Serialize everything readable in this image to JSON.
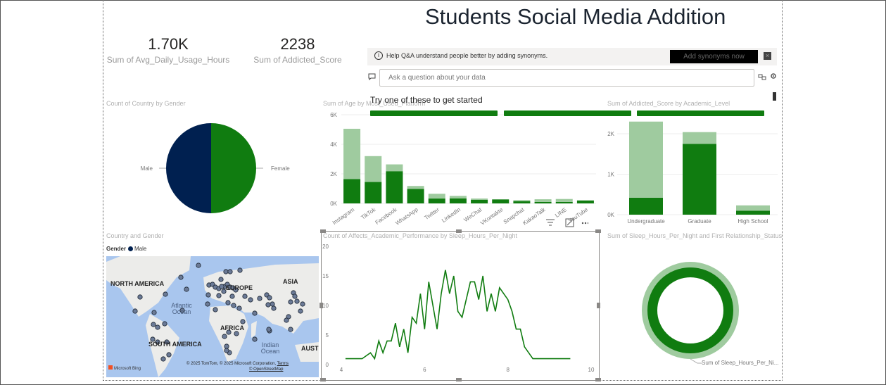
{
  "title": "Students Social Media Addition",
  "kpis": [
    {
      "value": "1.70K",
      "label": "Sum of Avg_Daily_Usage_Hours"
    },
    {
      "value": "2238",
      "label": "Sum of Addicted_Score"
    }
  ],
  "qa": {
    "banner_text": "Help Q&A understand people better by adding synonyms.",
    "add_synonyms_label": "Add synonyms now",
    "input_placeholder": "Ask a question about your data",
    "suggest_heading": "Try one of these to get started"
  },
  "colors": {
    "green": "#107c10",
    "light_green": "#9fcb9f",
    "navy": "#002050"
  },
  "chart_data": [
    {
      "type": "pie",
      "title": "Count of Country by Gender",
      "slices": [
        {
          "label": "Male",
          "value": 50,
          "color": "#002050"
        },
        {
          "label": "Female",
          "value": 50,
          "color": "#107c10"
        }
      ]
    },
    {
      "type": "bar",
      "title": "Sum of Age by Most_Used_Platform",
      "stacked": true,
      "categories": [
        "Instagram",
        "TikTok",
        "Facebook",
        "WhatsApp",
        "Twitter",
        "LinkedIn",
        "WeChat",
        "VKontakte",
        "Snapchat",
        "KakaoTalk",
        "LINE",
        "YouTube"
      ],
      "series": [
        {
          "values": [
            1650,
            1450,
            2180,
            980,
            330,
            340,
            250,
            270,
            150,
            100,
            100,
            200
          ],
          "color": "#107c10"
        },
        {
          "values": [
            3400,
            1750,
            460,
            200,
            320,
            170,
            80,
            0,
            80,
            180,
            200,
            0
          ],
          "color": "#9fcb9f"
        }
      ],
      "yticks": [
        "0K",
        "2K",
        "4K",
        "6K"
      ],
      "ylim": [
        0,
        6000
      ]
    },
    {
      "type": "bar",
      "title": "Sum of Addicted_Score by Academic_Level",
      "stacked": true,
      "categories": [
        "Undergraduate",
        "Graduate",
        "High School"
      ],
      "series": [
        {
          "values": [
            420,
            1750,
            100
          ],
          "color": "#107c10"
        },
        {
          "values": [
            1880,
            290,
            130
          ],
          "color": "#9fcb9f"
        }
      ],
      "yticks": [
        "0K",
        "1K",
        "2K"
      ],
      "ylim": [
        0,
        2400
      ]
    },
    {
      "type": "line",
      "title": "Count of Affects_Academic_Performance by Sleep_Hours_Per_Night",
      "x": [
        4.1,
        4.3,
        4.5,
        4.7,
        4.8,
        4.9,
        5.0,
        5.1,
        5.2,
        5.3,
        5.4,
        5.5,
        5.6,
        5.7,
        5.8,
        5.9,
        6.0,
        6.1,
        6.2,
        6.3,
        6.4,
        6.5,
        6.6,
        6.7,
        6.8,
        6.9,
        7.0,
        7.1,
        7.2,
        7.3,
        7.4,
        7.5,
        7.6,
        7.7,
        7.8,
        7.9,
        8.0,
        8.1,
        8.2,
        8.3,
        8.4,
        8.5,
        8.6,
        8.7,
        8.8,
        9.0,
        9.2,
        9.5
      ],
      "y": [
        1,
        1,
        1,
        2,
        1,
        4,
        2,
        4,
        4,
        7,
        3,
        6,
        2,
        8,
        7,
        12,
        6,
        14,
        10,
        6,
        12,
        16,
        12,
        15,
        9,
        8,
        11,
        14,
        14,
        11,
        15,
        9,
        12,
        9,
        13,
        12,
        11,
        9,
        6,
        6,
        3,
        2,
        1,
        1,
        1,
        1,
        1,
        1
      ],
      "xticks": [
        "4",
        "6",
        "8",
        "10"
      ],
      "yticks": [
        "0",
        "5",
        "10",
        "15",
        "20"
      ],
      "xlim": [
        4,
        10
      ],
      "ylim": [
        0,
        20
      ],
      "color": "#107c10"
    },
    {
      "type": "donut",
      "title": "Sum of Sleep_Hours_Per_Night and First Relationship_Status",
      "slices": [
        {
          "label": "Sum of Sleep_Hours_Per_Ni...",
          "value": 100
        }
      ]
    }
  ],
  "map": {
    "title": "Country and Gender",
    "legend_title": "Gender",
    "legend_item": "Male",
    "labels": [
      "NORTH AMERICA",
      "EUROPE",
      "ASIA",
      "AFRICA",
      "SOUTH AMERICA",
      "AUSTI"
    ],
    "oceans": [
      "Atlantic Ocean",
      "Indian Ocean"
    ],
    "attribution": "© 2025 TomTom, © 2025 Microsoft Corporation,",
    "terms": "Terms",
    "osm": "© OpenStreetMap",
    "logo": "Microsoft Bing"
  }
}
